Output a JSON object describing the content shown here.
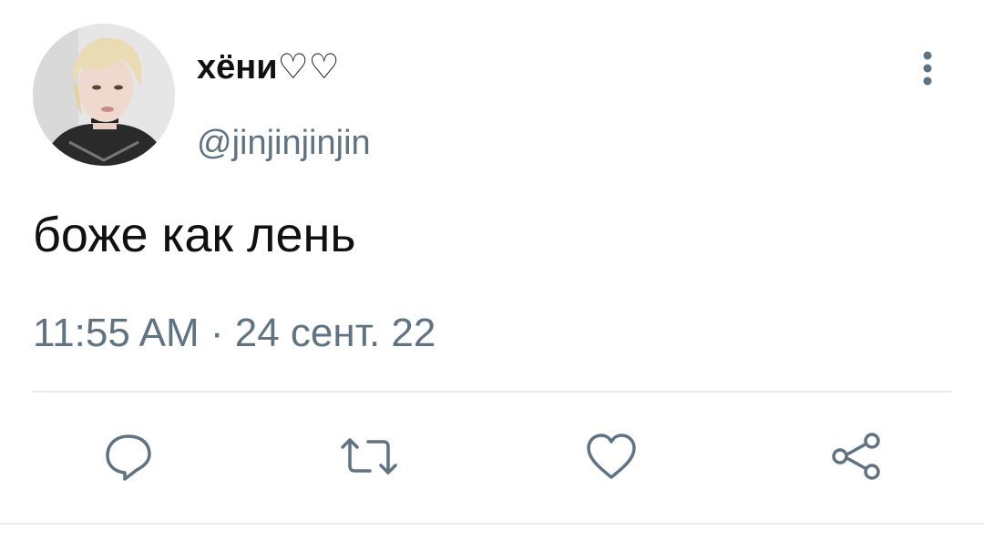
{
  "tweet": {
    "author": {
      "display_name": "хёни♡♡",
      "handle": "@jinjinjinjin"
    },
    "text": "боже как лень",
    "time": "11:55 AM",
    "separator": "·",
    "date": "24 сент. 22"
  },
  "actions": {
    "reply_icon": "speech-bubble",
    "retweet_icon": "retweet-arrows",
    "like_icon": "heart",
    "share_icon": "share-nodes"
  },
  "colors": {
    "primary_text": "#111111",
    "secondary_text": "#5f7383",
    "icon": "#5f7383",
    "divider": "#e6ebee"
  }
}
